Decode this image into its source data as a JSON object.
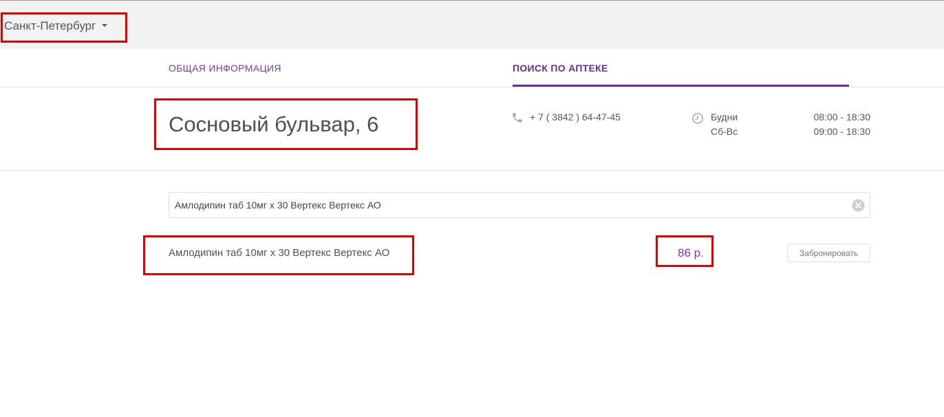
{
  "header": {
    "city": "Санкт-Петербург"
  },
  "tabs": [
    {
      "label": "ОБЩАЯ ИНФОРМАЦИЯ",
      "active": false
    },
    {
      "label": "ПОИСК ПО АПТЕКЕ",
      "active": true
    }
  ],
  "pharmacy": {
    "address": "Сосновый бульвар, 6",
    "phone": "+ 7 ( 3842 ) 64-47-45",
    "hours": [
      {
        "days": "Будни",
        "time": "08:00 - 18:30"
      },
      {
        "days": "Сб-Вс",
        "time": "09:00 - 18:30"
      }
    ]
  },
  "search": {
    "value": "Амлодипин таб 10мг х 30 Вертекс Вертекс АО"
  },
  "results": [
    {
      "name": "Амлодипин таб 10мг х 30 Вертекс Вертекс АО",
      "price": "86 р.",
      "action_label": "Забронировать"
    }
  ],
  "colors": {
    "accent": "#6d2e93",
    "highlight_box": "#e00000",
    "topbar_bg": "#f2f2f2"
  },
  "icons": {
    "city_dropdown": "caret-down-icon",
    "phone": "phone-icon",
    "hours": "clock-icon",
    "clear": "clear-icon"
  }
}
